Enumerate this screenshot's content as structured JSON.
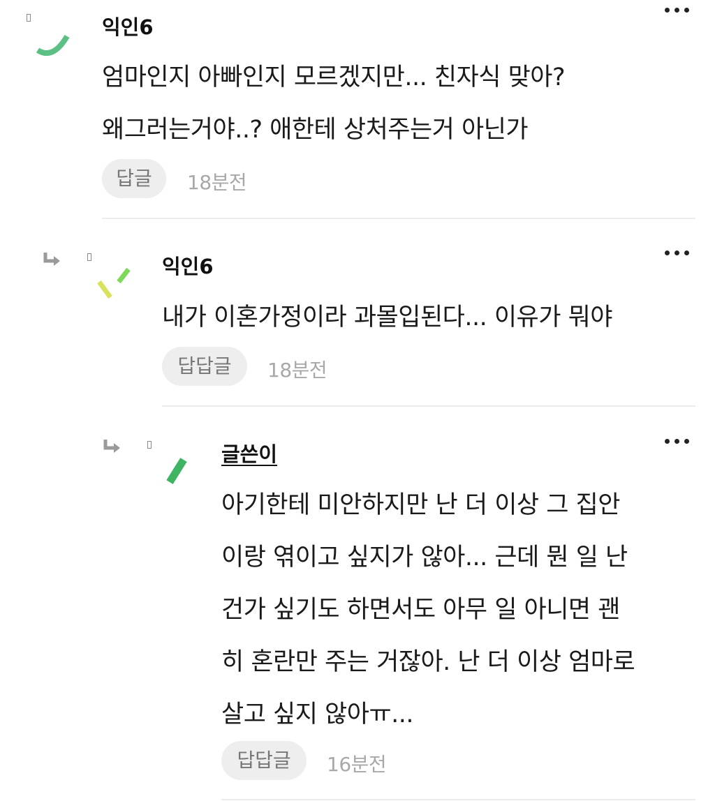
{
  "comments": [
    {
      "author": "익인6",
      "body": [
        "엄마인지 아빠인지 모르겠지만... 친자식 맞아?",
        "왜그러는거야..? 애한테 상처주는거 아닌가"
      ],
      "reply_label": "답글",
      "time": "18분전"
    },
    {
      "author": "익인6",
      "body": [
        "내가 이혼가정이라 과몰입된다... 이유가 뭐야"
      ],
      "reply_label": "답답글",
      "time": "18분전"
    },
    {
      "author": "글쓴이",
      "body": [
        "아기한테 미안하지만 난 더 이상 그 집안",
        "이랑 엮이고 싶지가 않아... 근데 뭔 일 난",
        "건가 싶기도 하면서도 아무 일 아니면 괜",
        "히 혼란만 주는 거잖아. 난 더 이상 엄마로",
        "살고 싶지 않아ㅠ..."
      ],
      "reply_label": "답답글",
      "time": "16분전"
    }
  ],
  "icons": {
    "more": "more-options-icon",
    "reply_arrow": "reply-arrow-icon",
    "avatar": "avatar-icon"
  },
  "colors": {
    "avatar_green": "#5cbf84",
    "avatar_lime": "#7ed957",
    "avatar_yellow": "#d8e25a",
    "avatar_dark_green": "#3fb564"
  }
}
